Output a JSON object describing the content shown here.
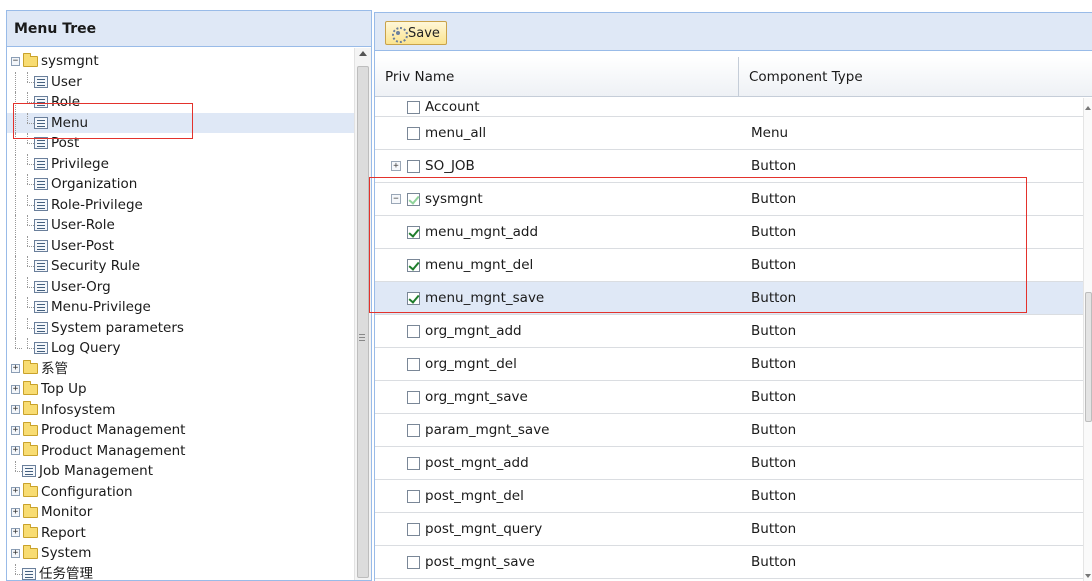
{
  "menu_tree": {
    "title": "Menu Tree",
    "nodes": [
      {
        "label": "sysmgnt",
        "type": "folder",
        "expander": "−"
      },
      {
        "label": "User",
        "type": "leaf"
      },
      {
        "label": "Role",
        "type": "leaf"
      },
      {
        "label": "Menu",
        "type": "leaf",
        "selected": true
      },
      {
        "label": "Post",
        "type": "leaf"
      },
      {
        "label": "Privilege",
        "type": "leaf"
      },
      {
        "label": "Organization",
        "type": "leaf"
      },
      {
        "label": "Role-Privilege",
        "type": "leaf"
      },
      {
        "label": "User-Role",
        "type": "leaf"
      },
      {
        "label": "User-Post",
        "type": "leaf"
      },
      {
        "label": "Security Rule",
        "type": "leaf"
      },
      {
        "label": "User-Org",
        "type": "leaf"
      },
      {
        "label": "Menu-Privilege",
        "type": "leaf"
      },
      {
        "label": "System parameters",
        "type": "leaf"
      },
      {
        "label": "Log Query",
        "type": "leaf"
      },
      {
        "label": "系管",
        "type": "folder",
        "expander": "+"
      },
      {
        "label": "Top Up",
        "type": "folder",
        "expander": "+"
      },
      {
        "label": "Infosystem",
        "type": "folder",
        "expander": "+"
      },
      {
        "label": "Product Management",
        "type": "folder",
        "expander": "+"
      },
      {
        "label": "Product Management",
        "type": "folder",
        "expander": "+"
      },
      {
        "label": "Job Management",
        "type": "leaf"
      },
      {
        "label": "Configuration",
        "type": "folder",
        "expander": "+"
      },
      {
        "label": "Monitor",
        "type": "folder",
        "expander": "+"
      },
      {
        "label": "Report",
        "type": "folder",
        "expander": "+"
      },
      {
        "label": "System",
        "type": "folder",
        "expander": "+"
      },
      {
        "label": "任务管理",
        "type": "leaf"
      }
    ]
  },
  "toolbar": {
    "save_label": "Save",
    "save_icon": "save-icon"
  },
  "grid": {
    "columns": [
      "Priv Name",
      "Component Type"
    ],
    "rows": [
      {
        "name": "Account",
        "type": "",
        "checked": false,
        "expander": "",
        "indent": 1
      },
      {
        "name": "menu_all",
        "type": "Menu",
        "checked": false,
        "expander": "",
        "indent": 1
      },
      {
        "name": "SO_JOB",
        "type": "Button",
        "checked": false,
        "expander": "+",
        "indent": 0
      },
      {
        "name": "sysmgnt",
        "type": "Button",
        "checked": "partial",
        "expander": "−",
        "indent": 0
      },
      {
        "name": "menu_mgnt_add",
        "type": "Button",
        "checked": true,
        "expander": "",
        "indent": 1
      },
      {
        "name": "menu_mgnt_del",
        "type": "Button",
        "checked": true,
        "expander": "",
        "indent": 1
      },
      {
        "name": "menu_mgnt_save",
        "type": "Button",
        "checked": true,
        "expander": "",
        "indent": 1,
        "selected": true
      },
      {
        "name": "org_mgnt_add",
        "type": "Button",
        "checked": false,
        "expander": "",
        "indent": 1
      },
      {
        "name": "org_mgnt_del",
        "type": "Button",
        "checked": false,
        "expander": "",
        "indent": 1
      },
      {
        "name": "org_mgnt_save",
        "type": "Button",
        "checked": false,
        "expander": "",
        "indent": 1
      },
      {
        "name": "param_mgnt_save",
        "type": "Button",
        "checked": false,
        "expander": "",
        "indent": 1
      },
      {
        "name": "post_mgnt_add",
        "type": "Button",
        "checked": false,
        "expander": "",
        "indent": 1
      },
      {
        "name": "post_mgnt_del",
        "type": "Button",
        "checked": false,
        "expander": "",
        "indent": 1
      },
      {
        "name": "post_mgnt_query",
        "type": "Button",
        "checked": false,
        "expander": "",
        "indent": 1
      },
      {
        "name": "post_mgnt_save",
        "type": "Button",
        "checked": false,
        "expander": "",
        "indent": 1
      }
    ]
  },
  "colors": {
    "header_bg": "#dfe8f6",
    "border": "#99bbe8",
    "selection": "#dfe8f6",
    "highlight_box": "#e3322c",
    "save_button": "#fbe48f"
  }
}
